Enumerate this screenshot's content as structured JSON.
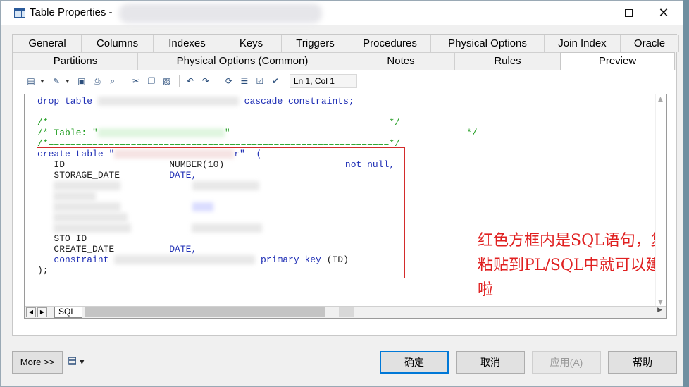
{
  "window": {
    "title": "Table Properties - "
  },
  "tabs_row1": [
    "General",
    "Columns",
    "Indexes",
    "Keys",
    "Triggers",
    "Procedures",
    "Physical Options",
    "Join Index",
    "Oracle"
  ],
  "tabs_row2": [
    "Partitions",
    "Physical Options (Common)",
    "Notes",
    "Rules",
    "Preview"
  ],
  "active_tab": "Preview",
  "toolbar": {
    "cursor_position": "Ln 1, Col 1"
  },
  "code": {
    "line1_kw": "drop table",
    "line1_end": "cascade constraints;",
    "comment_line": "/*==============================================================*/",
    "comment_table": "/* Table: \"",
    "comment_table_end": "\"                                           */",
    "create_kw": "create table",
    "create_quote": "\"",
    "create_end": "r\"  (",
    "col_id": "ID",
    "col_id_type": "NUMBER(10)",
    "col_id_null": "not null,",
    "col_storage": "STORAGE_DATE",
    "col_storage_type": "DATE,",
    "col_sto_id": "STO_ID",
    "col_create_date": "CREATE_DATE",
    "col_create_type": "DATE,",
    "constraint_kw": "constraint",
    "pk_text": "primary key",
    "pk_col": "(ID)",
    "close": ");"
  },
  "annotation": "红色方框内是SQL语句，复制粘贴到PL/SQL中就可以建表啦",
  "sql_tab": "SQL",
  "buttons": {
    "more": "More >>",
    "ok": "确定",
    "cancel": "取消",
    "apply": "应用(A)",
    "help": "帮助"
  },
  "colors": {
    "keyword": "#1f2fb5",
    "comment": "#1a9a1a",
    "highlight_box": "#d32b2b",
    "annotation": "#e02020"
  }
}
